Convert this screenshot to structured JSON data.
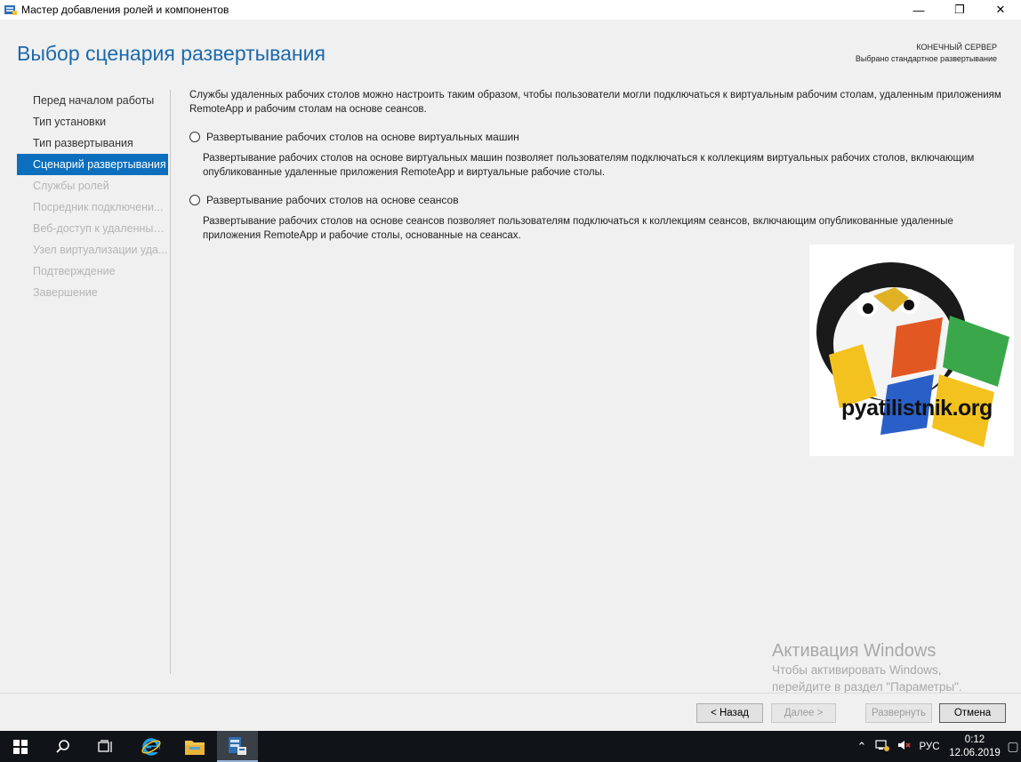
{
  "window": {
    "title": "Мастер добавления ролей и компонентов",
    "controls": {
      "minimize": "—",
      "maximize": "❐",
      "close": "✕"
    }
  },
  "header": {
    "page_title": "Выбор сценария развертывания",
    "server_label": "КОНЕЧНЫЙ СЕРВЕР",
    "server_value": "Выбрано стандартное развертывание"
  },
  "nav": {
    "items": [
      {
        "label": "Перед началом работы",
        "state": "enabled"
      },
      {
        "label": "Тип установки",
        "state": "enabled"
      },
      {
        "label": "Тип развертывания",
        "state": "enabled"
      },
      {
        "label": "Сценарий развертывания",
        "state": "active"
      },
      {
        "label": "Службы ролей",
        "state": "disabled"
      },
      {
        "label": "Посредник подключени...",
        "state": "disabled"
      },
      {
        "label": "Веб-доступ к удаленным...",
        "state": "disabled"
      },
      {
        "label": "Узел виртуализации уда...",
        "state": "disabled"
      },
      {
        "label": "Подтверждение",
        "state": "disabled"
      },
      {
        "label": "Завершение",
        "state": "disabled"
      }
    ]
  },
  "content": {
    "intro": "Службы удаленных рабочих столов можно настроить таким образом, чтобы пользователи могли подключаться к виртуальным рабочим столам, удаленным приложениям RemoteApp и рабочим столам на основе сеансов.",
    "options": [
      {
        "label": "Развертывание рабочих столов на основе виртуальных машин",
        "description": "Развертывание рабочих столов на основе виртуальных машин позволяет пользователям подключаться к коллекциям виртуальных рабочих столов, включающим опубликованные удаленные приложения RemoteApp и виртуальные рабочие столы.",
        "selected": false
      },
      {
        "label": "Развертывание рабочих столов на основе сеансов",
        "description": "Развертывание рабочих столов на основе сеансов позволяет пользователям подключаться к коллекциям сеансов, включающим опубликованные удаленные приложения RemoteApp и рабочие столы, основанные на сеансах.",
        "selected": false
      }
    ]
  },
  "watermark": {
    "logo_text": "pyatilistnik.org"
  },
  "activation": {
    "title": "Активация Windows",
    "line1": "Чтобы активировать Windows,",
    "line2": "перейдите в раздел \"Параметры\"."
  },
  "footer": {
    "back": "< Назад",
    "next": "Далее >",
    "deploy": "Развернуть",
    "cancel": "Отмена"
  },
  "taskbar": {
    "language": "РУС",
    "time": "0:12",
    "date": "12.06.2019"
  },
  "colors": {
    "accent": "#0b6fbe",
    "title_blue": "#1b6aad",
    "taskbar": "#101418"
  }
}
